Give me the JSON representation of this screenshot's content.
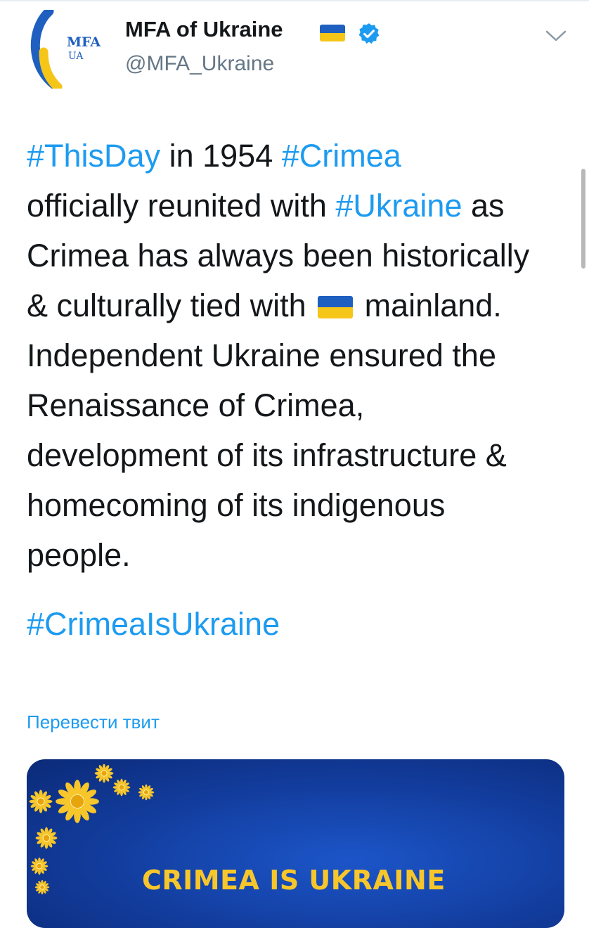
{
  "account": {
    "display_name": "MFA of Ukraine",
    "handle": "@MFA_Ukraine",
    "avatar_text_top": "MFA",
    "avatar_text_bottom": "UA",
    "verified_icon": "verified-badge-icon",
    "flag_icon": "ukraine-flag-icon"
  },
  "tweet": {
    "lines": [
      [
        {
          "t": "#ThisDay",
          "tag": true
        },
        {
          "t": " in 1954 "
        },
        {
          "t": "#Crimea",
          "tag": true
        }
      ],
      [
        {
          "t": "officially reunited with "
        },
        {
          "t": "#Ukraine",
          "tag": true
        },
        {
          "t": " as"
        }
      ],
      [
        {
          "t": "Crimea has always been historically"
        }
      ],
      [
        {
          "t": "& culturally tied with "
        },
        {
          "flag": true
        },
        {
          "t": " mainland."
        }
      ],
      [
        {
          "t": "Independent Ukraine ensured the"
        }
      ],
      [
        {
          "t": "Renaissance of Crimea,"
        }
      ],
      [
        {
          "t": "development of its infrastructure &"
        }
      ],
      [
        {
          "t": "homecoming of its indigenous"
        }
      ],
      [
        {
          "t": "people."
        }
      ]
    ],
    "hashtag": "#CrimeaIsUkraine",
    "translate_label": "Перевести твит"
  },
  "media": {
    "caption": "CRIMEA IS UKRAINE"
  },
  "colors": {
    "link": "#1d9bf0",
    "text": "#14171a",
    "secondary": "#657786",
    "flag_blue": "#1f5fbf",
    "flag_yellow": "#f5c518",
    "media_bg": "#123c9c",
    "caption": "#f7c62a"
  }
}
